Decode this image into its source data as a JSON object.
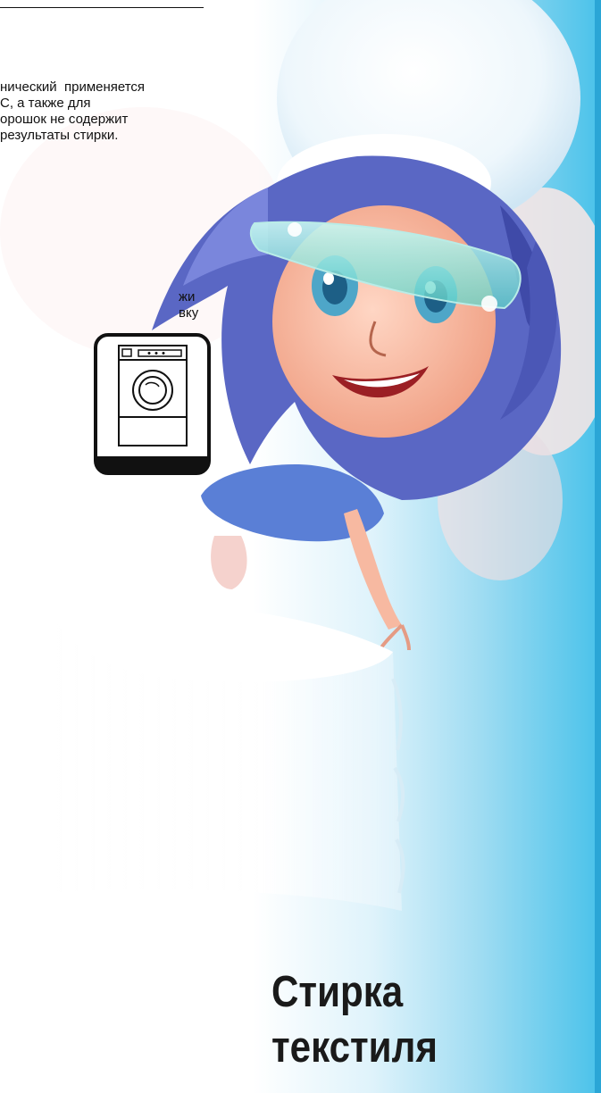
{
  "text_block_1": [
    "нический  применяется",
    "С, а также для",
    "орошок не содержит",
    "результаты стирки."
  ],
  "text_block_2": [
    "жи",
    "вку"
  ],
  "title": {
    "line1": "Стирка",
    "line2": "текстиля"
  },
  "icons": {
    "washer": "washing-machine-icon",
    "fairy": "fairy-illustration"
  },
  "colors": {
    "sky": "#49c2ea",
    "hair": "#5a67c4",
    "skin": "#f7b9a1",
    "visor": "#7fe3d8",
    "text": "#1a1a1a"
  }
}
